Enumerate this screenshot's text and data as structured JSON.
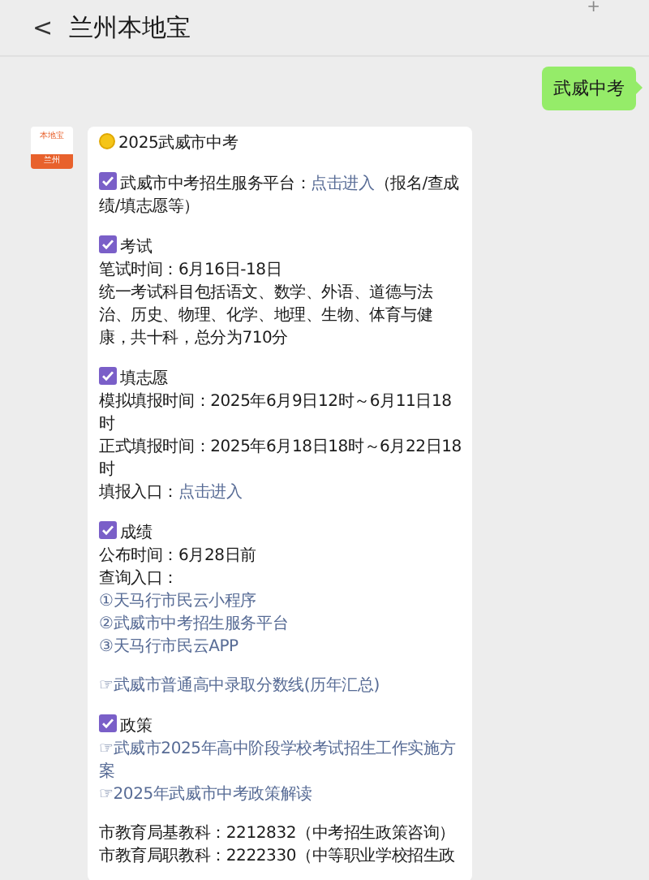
{
  "header": {
    "back": "<",
    "title": "兰州本地宝",
    "more": "+"
  },
  "outgoing": {
    "text": "武威中考"
  },
  "avatar": {
    "top": "本地宝",
    "bottom": "兰州"
  },
  "message": {
    "paragraphs": [
      [
        {
          "kind": "dot",
          "parts": [
            {
              "text": "2025武威市中考"
            }
          ]
        }
      ],
      [
        {
          "kind": "heading",
          "parts": [
            {
              "text": "武威市中考招生服务平台："
            },
            {
              "text": "点击进入",
              "link": true
            },
            {
              "text": "（报名/查成绩/填志愿等）"
            }
          ]
        }
      ],
      [
        {
          "kind": "heading",
          "parts": [
            {
              "text": "考试"
            }
          ]
        },
        {
          "kind": "text",
          "parts": [
            {
              "text": "笔试时间：6月16日-18日"
            }
          ]
        },
        {
          "kind": "text",
          "parts": [
            {
              "text": "统一考试科目包括语文、数学、外语、道德与法治、历史、物理、化学、地理、生物、体育与健康，共十科，总分为710分"
            }
          ]
        }
      ],
      [
        {
          "kind": "heading",
          "parts": [
            {
              "text": "填志愿"
            }
          ]
        },
        {
          "kind": "text",
          "parts": [
            {
              "text": "模拟填报时间：2025年6月9日12时～6月11日18时"
            }
          ]
        },
        {
          "kind": "text",
          "parts": [
            {
              "text": "正式填报时间：2025年6月18日18时～6月22日18时"
            }
          ]
        },
        {
          "kind": "text",
          "parts": [
            {
              "text": "填报入口："
            },
            {
              "text": "点击进入",
              "link": true
            }
          ]
        }
      ],
      [
        {
          "kind": "heading",
          "parts": [
            {
              "text": "成绩"
            }
          ]
        },
        {
          "kind": "text",
          "parts": [
            {
              "text": "公布时间：6月28日前"
            }
          ]
        },
        {
          "kind": "text",
          "parts": [
            {
              "text": "查询入口："
            }
          ]
        },
        {
          "kind": "text",
          "parts": [
            {
              "text": "①天马行市民云小程序",
              "link": true
            }
          ]
        },
        {
          "kind": "text",
          "parts": [
            {
              "text": "②武威市中考招生服务平台",
              "link": true
            }
          ]
        },
        {
          "kind": "text",
          "parts": [
            {
              "text": "③天马行市民云APP",
              "link": true
            }
          ]
        }
      ],
      [
        {
          "kind": "text",
          "parts": [
            {
              "text": "☞武威市普通高中录取分数线(历年汇总)",
              "link": true
            }
          ]
        }
      ],
      [
        {
          "kind": "heading",
          "parts": [
            {
              "text": "政策"
            }
          ]
        },
        {
          "kind": "text",
          "parts": [
            {
              "text": "☞武威市2025年高中阶段学校考试招生工作实施方案",
              "link": true
            }
          ]
        },
        {
          "kind": "text",
          "parts": [
            {
              "text": "☞2025年武威市中考政策解读",
              "link": true
            }
          ]
        }
      ],
      [
        {
          "kind": "text",
          "parts": [
            {
              "text": "市教育局基教科：2212832（中考招生政策咨询）"
            }
          ]
        },
        {
          "kind": "text",
          "parts": [
            {
              "text": "市教育局职教科：2222330（中等职业学校招生政"
            }
          ]
        }
      ]
    ]
  }
}
